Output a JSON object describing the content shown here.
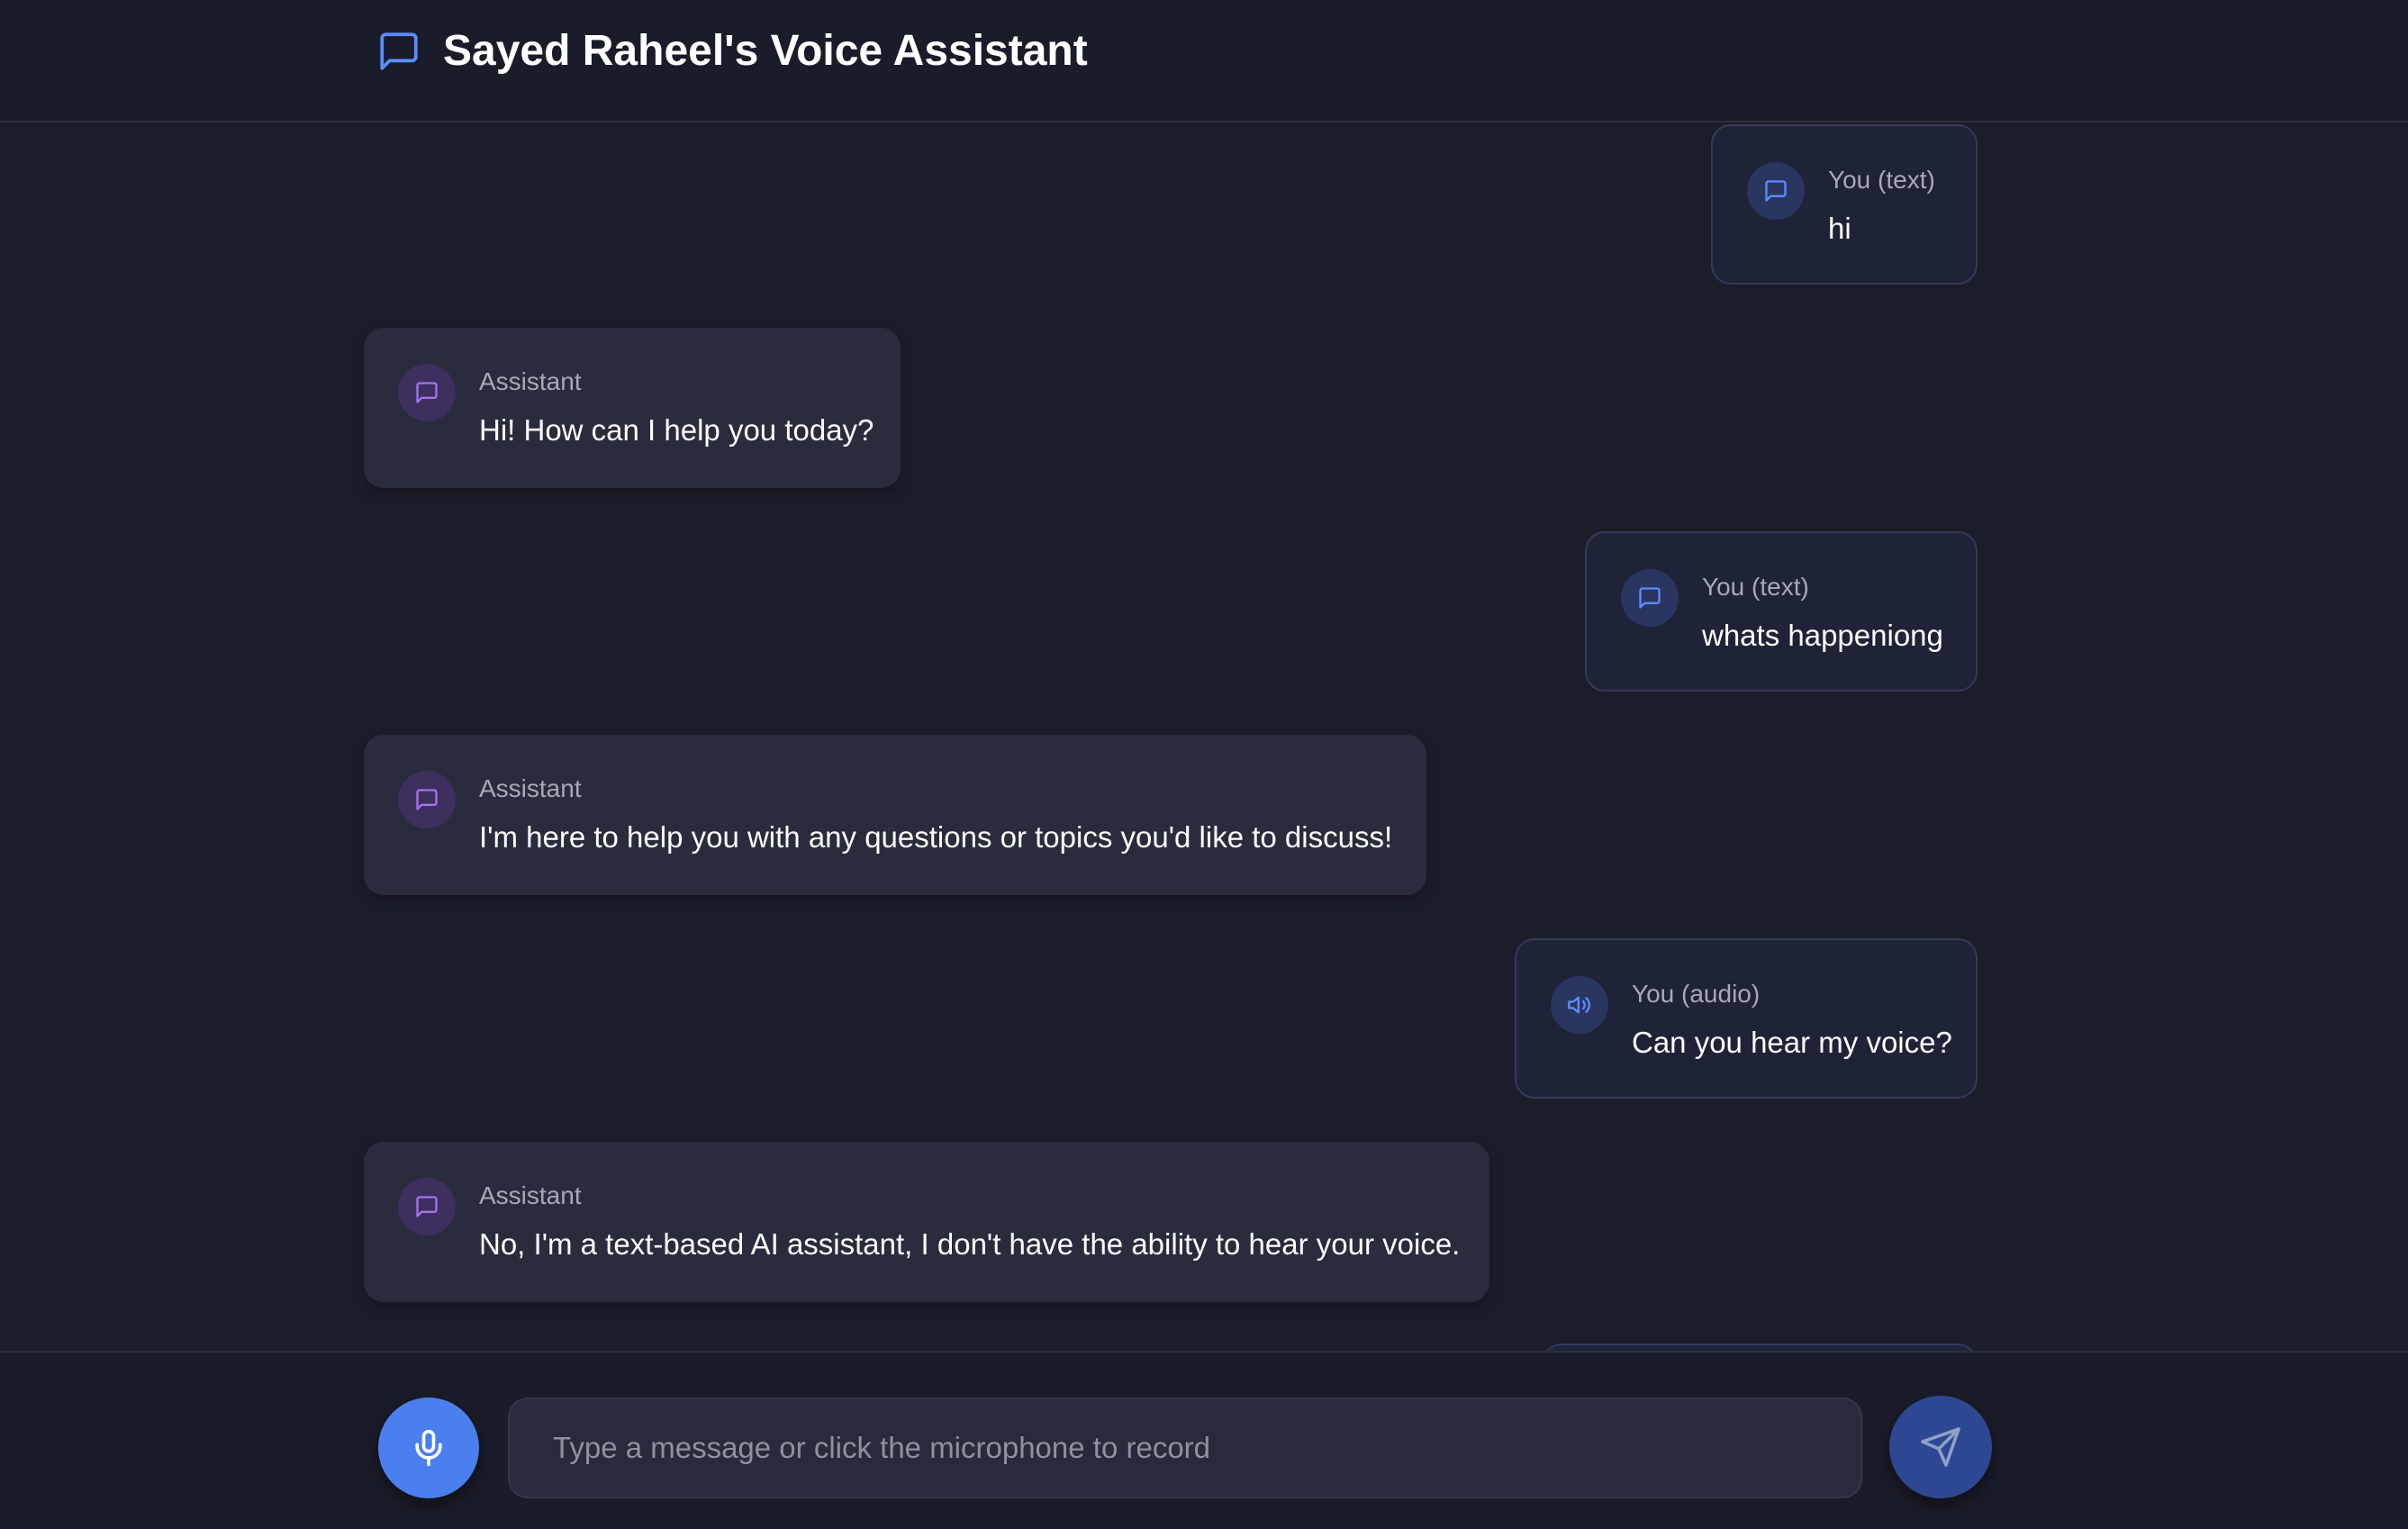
{
  "header": {
    "title": "Sayed Raheel's Voice Assistant",
    "icon": "chat-bubble-icon"
  },
  "colors": {
    "accent": "#4a7ff0",
    "user_icon": "#5b8dff",
    "assistant_icon": "#a374f0",
    "background": "#1c1d2b"
  },
  "messages": [
    {
      "role": "user",
      "label": "You (text)",
      "text": "hi",
      "icon": "message-icon"
    },
    {
      "role": "assistant",
      "label": "Assistant",
      "text": "Hi! How can I help you today?",
      "icon": "message-icon"
    },
    {
      "role": "user",
      "label": "You (text)",
      "text": "whats happeniong",
      "icon": "message-icon"
    },
    {
      "role": "assistant",
      "label": "Assistant",
      "text": "I'm here to help you with any questions or topics you'd like to discuss!",
      "icon": "message-icon"
    },
    {
      "role": "user",
      "label": "You (audio)",
      "text": "Can you hear my voice?",
      "icon": "speaker-icon"
    },
    {
      "role": "assistant",
      "label": "Assistant",
      "text": "No, I'm a text-based AI assistant, I don't have the ability to hear your voice.",
      "icon": "message-icon"
    }
  ],
  "input": {
    "placeholder": "Type a message or click the microphone to record",
    "value": "",
    "mic_icon": "microphone-icon",
    "send_icon": "send-icon"
  }
}
